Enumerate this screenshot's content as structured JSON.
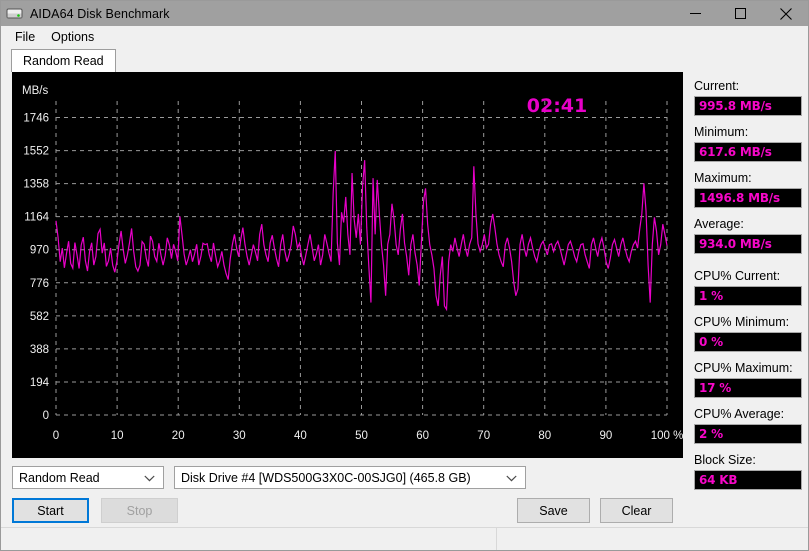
{
  "window": {
    "title": "AIDA64 Disk Benchmark",
    "icon": "disk-drive-icon",
    "minimize_label": "minimize-icon",
    "maximize_label": "maximize-icon",
    "close_label": "close-icon"
  },
  "menu": {
    "items": [
      {
        "label": "File"
      },
      {
        "label": "Options"
      }
    ]
  },
  "tabs": [
    {
      "label": "Random Read",
      "active": true
    }
  ],
  "chart_data": {
    "type": "line",
    "title": "",
    "timer": "02:41",
    "xlabel": "",
    "ylabel": "MB/s",
    "unit_label": "MB/s",
    "x_unit_suffix": "%",
    "xticks": [
      "0",
      "10",
      "20",
      "30",
      "40",
      "50",
      "60",
      "70",
      "80",
      "90",
      "100 %"
    ],
    "xvalues": [
      0,
      10,
      20,
      30,
      40,
      50,
      60,
      70,
      80,
      90,
      100
    ],
    "yticks": [
      "0",
      "194",
      "388",
      "582",
      "776",
      "970",
      "1164",
      "1358",
      "1552",
      "1746"
    ],
    "yvalues": [
      0,
      194,
      388,
      582,
      776,
      970,
      1164,
      1358,
      1552,
      1746
    ],
    "ylim": [
      0,
      1843
    ],
    "xlim": [
      0,
      100
    ],
    "grid": true,
    "line_color": "#e800c8",
    "background": "#000000",
    "grid_color": "#9a9a9a",
    "axis_text_color": "#f0f0f0",
    "series": [
      {
        "name": "Random Read",
        "values": [
          1140,
          1041,
          900,
          980,
          864,
          948,
          1020,
          889,
          862,
          1012,
          940,
          860,
          997,
          1044,
          905,
          845,
          960,
          1011,
          880,
          930,
          1065,
          1090,
          950,
          1010,
          872,
          905,
          980,
          880,
          838,
          900,
          1002,
          1080,
          972,
          890,
          940,
          1010,
          1095,
          960,
          870,
          845,
          880,
          1018,
          1002,
          920,
          872,
          1050,
          1020,
          930,
          902,
          1008,
          938,
          880,
          935,
          1040,
          999,
          918,
          1002,
          960,
          905,
          1166,
          1060,
          945,
          880,
          920,
          970,
          900,
          945,
          1002,
          880,
          930,
          1008,
          1000,
          1005,
          940,
          900,
          1010,
          935,
          870,
          905,
          960,
          880,
          830,
          795,
          918,
          1000,
          1060,
          980,
          930,
          1030,
          1100,
          1002,
          930,
          880,
          940,
          1000,
          955,
          905,
          1060,
          1120,
          1000,
          940,
          900,
          1010,
          1055,
          980,
          918,
          870,
          1000,
          1060,
          960,
          900,
          940,
          1000,
          1110,
          1060,
          980,
          1008,
          930,
          880,
          940,
          1002,
          1060,
          980,
          905,
          945,
          1000,
          880,
          940,
          1060,
          1008,
          950,
          900,
          1300,
          1550,
          1010,
          880,
          1190,
          1130,
          1280,
          1060,
          940,
          1420,
          1150,
          1040,
          1180,
          1000,
          1340,
          1496,
          1100,
          870,
          660,
          1390,
          1060,
          1380,
          1180,
          1000,
          880,
          700,
          1002,
          1060,
          1240,
          1150,
          1000,
          940,
          1090,
          1180,
          1010,
          930,
          820,
          1000,
          1060,
          950,
          880,
          760,
          1010,
          1250,
          1330,
          1120,
          1000,
          940,
          860,
          700,
          640,
          820,
          930,
          640,
          620,
          900,
          1000,
          960,
          1040,
          980,
          930,
          1000,
          1060,
          980,
          930,
          1002,
          1040,
          1460,
          1180,
          1005,
          960,
          1000,
          1060,
          980,
          1002,
          1120,
          1180,
          1100,
          1005,
          940,
          900,
          870,
          1000,
          1040,
          980,
          900,
          780,
          700,
          740,
          1000,
          1060,
          980,
          930,
          1002,
          1040,
          980,
          930,
          900,
          960,
          1000,
          1020,
          980,
          940,
          1000,
          1005,
          960,
          1000,
          1020,
          980,
          930,
          880,
          940,
          1000,
          1020,
          980,
          930,
          900,
          960,
          1000,
          1005,
          940,
          900,
          860,
          1000,
          1040,
          980,
          930,
          1002,
          1040,
          980,
          900,
          860,
          920,
          1000,
          1030,
          980,
          930,
          1000,
          1040,
          980,
          930,
          900,
          960,
          1000,
          1020,
          980,
          1090,
          1180,
          1360,
          1200,
          880,
          660,
          1000,
          1160,
          1080,
          940,
          1000,
          1120,
          1060,
          995
        ]
      }
    ]
  },
  "sidebar": {
    "stats": [
      {
        "label": "Current:",
        "value": "995.8 MB/s",
        "name": "current"
      },
      {
        "label": "Minimum:",
        "value": "617.6 MB/s",
        "name": "minimum"
      },
      {
        "label": "Maximum:",
        "value": "1496.8 MB/s",
        "name": "maximum"
      },
      {
        "label": "Average:",
        "value": "934.0 MB/s",
        "name": "average"
      },
      {
        "label": "CPU% Current:",
        "value": "1 %",
        "name": "cpu-current"
      },
      {
        "label": "CPU% Minimum:",
        "value": "0 %",
        "name": "cpu-minimum"
      },
      {
        "label": "CPU% Maximum:",
        "value": "17 %",
        "name": "cpu-maximum"
      },
      {
        "label": "CPU% Average:",
        "value": "2 %",
        "name": "cpu-average"
      },
      {
        "label": "Block Size:",
        "value": "64 KB",
        "name": "block-size"
      }
    ]
  },
  "controls": {
    "mode_select": {
      "value": "Random Read",
      "options": [
        "Random Read"
      ]
    },
    "drive_select": {
      "value": "Disk Drive #4  [WDS500G3X0C-00SJG0]  (465.8 GB)",
      "options": [
        "Disk Drive #4  [WDS500G3X0C-00SJG0]  (465.8 GB)"
      ]
    },
    "start_label": "Start",
    "stop_label": "Stop",
    "save_label": "Save",
    "clear_label": "Clear"
  },
  "statusbar": {
    "cell1": "",
    "cell2": ""
  },
  "colors": {
    "accent_magenta": "#f707c8",
    "line": "#e800c8",
    "focus_blue": "#0078d7",
    "chart_bg": "#000000"
  }
}
